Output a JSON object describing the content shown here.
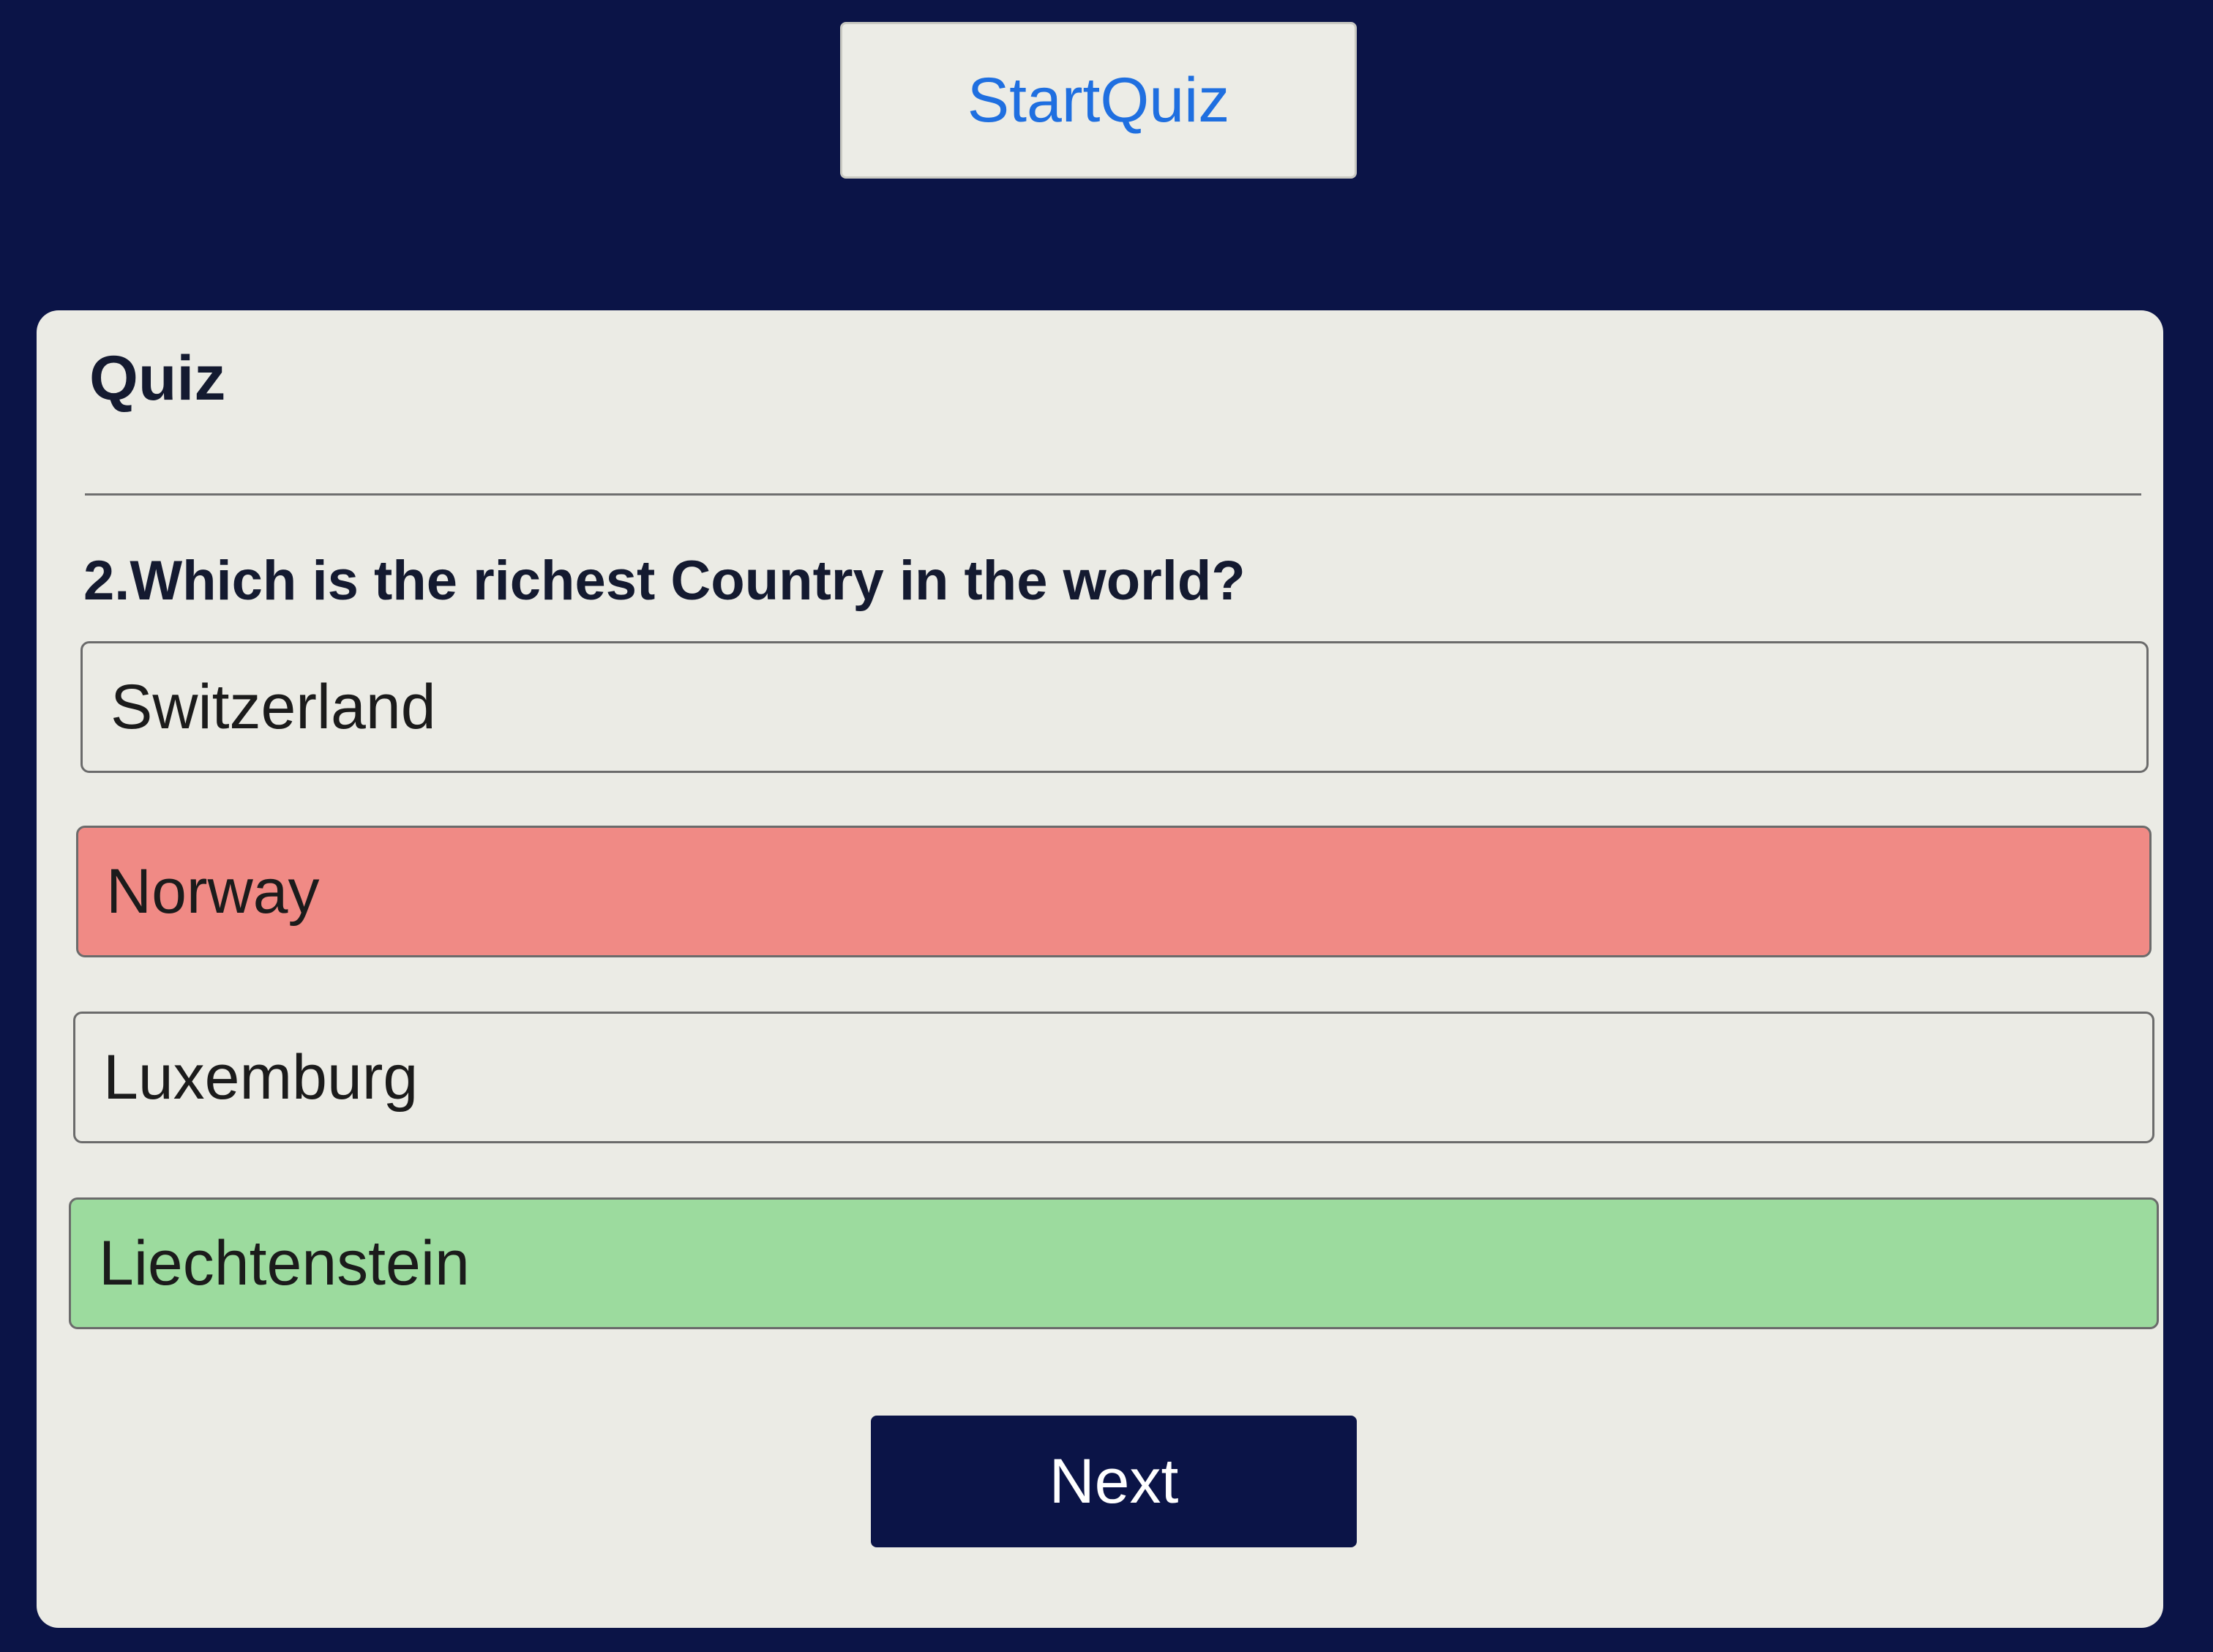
{
  "header": {
    "start_label": "StartQuiz"
  },
  "quiz": {
    "title": "Quiz",
    "question": "2.Which is the richest Country in the world?",
    "options": [
      {
        "label": "Switzerland",
        "state": "neutral"
      },
      {
        "label": "Norway",
        "state": "wrong"
      },
      {
        "label": "Luxemburg",
        "state": "neutral"
      },
      {
        "label": "Liechtenstein",
        "state": "correct"
      }
    ],
    "next_label": "Next"
  },
  "colors": {
    "page_background": "#0b1447",
    "card_background": "#ebebe5",
    "wrong": "#f08a85",
    "correct": "#9cdb9e",
    "start_text": "#1f6fe0",
    "next_background": "#0b1447"
  }
}
